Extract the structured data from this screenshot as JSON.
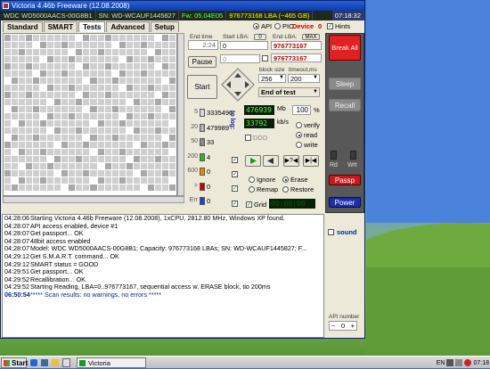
{
  "window": {
    "title": "Victoria 4.46b Freeware (12.08.2008)",
    "model": "WDC WD5000AACS-00G8B1",
    "serial": "SN: WD-WCAUF1445827",
    "firmware": "Fw: 05.04E05",
    "lba_info": "976773168 LBA (~465 GB)",
    "clock": "07:18:32"
  },
  "tabs": [
    "Standard",
    "SMART",
    "Tests",
    "Advanced",
    "Setup"
  ],
  "active_tab": "Tests",
  "mode": {
    "api": "API",
    "pio": "PIO",
    "device_label": "Device",
    "device_value": "0",
    "hints": "Hints"
  },
  "controls": {
    "end_time_label": "End time",
    "end_time_value": "2:24",
    "start_lba_label": "Start LBA:",
    "start_lba_value": "0",
    "end_lba_label": "End LBA:",
    "end_lba_btn": "MAX",
    "end_lba_value": "976773167",
    "end_lba_value2": "976773167",
    "pause": "Pause",
    "start": "Start",
    "zero_btn": "0",
    "current_value": "0",
    "block_size_label": "block size",
    "block_size_value": "256",
    "timeout_label": "timeout,ms",
    "timeout_value": "200",
    "end_of_test": "End of test"
  },
  "timing": {
    "rows": [
      {
        "ms": "5",
        "count": "3335496",
        "color": "#d8d8d8"
      },
      {
        "ms": "20",
        "count": "479989",
        "color": "#b0b0b0"
      },
      {
        "ms": "50",
        "count": "33",
        "color": "#888888"
      },
      {
        "ms": "200",
        "count": "4",
        "color": "#22bb22"
      },
      {
        "ms": "600",
        "count": "0",
        "color": "#ee8800"
      },
      {
        "ms": ">",
        "count": "0",
        "color": "#cc0000"
      },
      {
        "ms": "Err",
        "count": "0",
        "color": "#2244cc"
      }
    ],
    "to_log_label": "to log:"
  },
  "progress": {
    "mb_done": "476939",
    "mb_unit": "Mb",
    "percent": "100",
    "percent_unit": "%",
    "speed": "33792",
    "speed_unit": "kb/s",
    "ddd_label": "DDD",
    "verify": "verify",
    "read": "read",
    "write": "write",
    "grid_label": "Grid",
    "grid_time": "00:00:00",
    "ignore": "Ignore",
    "erase": "Erase",
    "remap": "Remap",
    "restore": "Restore"
  },
  "sidebar": {
    "break_all": "Break All",
    "sleep": "Sleep",
    "recall": "Recall",
    "rd": "Rd",
    "wrt": "Wrt",
    "passp": "Passp",
    "power": "Power",
    "sound": "sound",
    "api_number_label": "API number",
    "api_number_value": "0"
  },
  "log": [
    {
      "time": "04:28:06",
      "text": "Starting Victoria 4.46b Freeware (12.08.2008), 1xCPU, 2812.80 MHz, Windows XP found."
    },
    {
      "time": "04:28:07",
      "text": "API access enabled, device #1"
    },
    {
      "time": "04:28:07",
      "text": "Get passport... OK"
    },
    {
      "time": "04:28:07",
      "text": "48bit access enabled"
    },
    {
      "time": "04:28:07",
      "text": "Model: WDC WD5000AACS-00G8B1; Capacity: 976773168 LBAs; SN: WD-WCAUF1445827; F..."
    },
    {
      "time": "04:29:12",
      "text": "Get S.M.A.R.T. command... OK"
    },
    {
      "time": "04:29:12",
      "text": "SMART status = GOOD"
    },
    {
      "time": "04:29:51",
      "text": "Get passport... OK"
    },
    {
      "time": "04:29:52",
      "text": "Recallibration... OK"
    },
    {
      "time": "04:29:52",
      "text": "Starting Reading, LBA=0..976773167, sequential access w. ERASE block, tio 200ms"
    },
    {
      "time": "06:50:54",
      "text": "***** Scan results: no warnings, no errors *****",
      "highlight": true
    }
  ],
  "taskbar": {
    "start": "Start",
    "task": "Victoria",
    "lang": "EN",
    "time": "07:18"
  }
}
